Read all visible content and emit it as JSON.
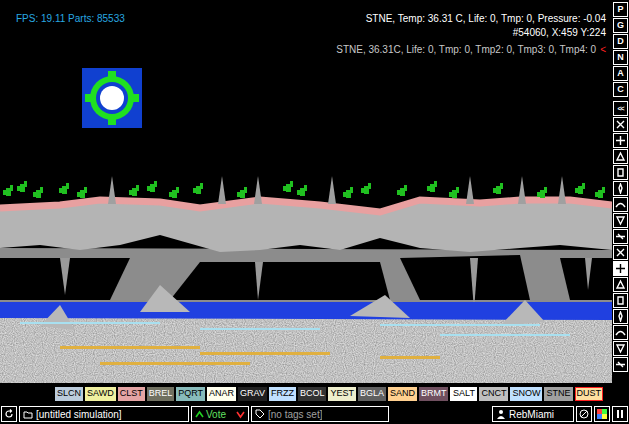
{
  "hud": {
    "fps": "FPS: 19.11 Parts: 85533",
    "lines": [
      "STNE, Temp: 36.31 C, Life: 0, Tmp: 0, Pressure: -0.04",
      "#54060, X:459 Y:224"
    ],
    "detail": "STNE, 36.31C, Life: 0, Tmp: 0, Tmp2: 0, Tmp3: 0, Tmp4: 0",
    "detail_marker": "<"
  },
  "sidebar": {
    "modes": [
      {
        "label": "P",
        "selected": false
      },
      {
        "label": "G",
        "selected": false
      },
      {
        "label": "D",
        "selected": false
      },
      {
        "label": "N",
        "selected": false
      },
      {
        "label": "A",
        "selected": false
      },
      {
        "label": "C",
        "selected": false
      }
    ],
    "collapse": "<<",
    "categories": [
      {
        "selected": false
      },
      {
        "selected": false
      },
      {
        "selected": false
      },
      {
        "selected": false
      },
      {
        "selected": false
      },
      {
        "selected": false
      },
      {
        "selected": false
      },
      {
        "selected": false
      },
      {
        "selected": false
      },
      {
        "selected": true
      },
      {
        "selected": false
      },
      {
        "selected": false
      },
      {
        "selected": false
      },
      {
        "selected": false
      },
      {
        "selected": false
      },
      {
        "selected": false
      }
    ]
  },
  "elements": [
    {
      "label": "SLCN",
      "color": "#bcccdc",
      "selected": false
    },
    {
      "label": "SAWD",
      "color": "#f0f0a0",
      "selected": false
    },
    {
      "label": "CLST",
      "color": "#e4a4a4",
      "selected": false
    },
    {
      "label": "BREL",
      "color": "#707060",
      "selected": false
    },
    {
      "label": "PQRT",
      "color": "#88bbbb",
      "selected": false
    },
    {
      "label": "ANAR",
      "color": "#ffffee",
      "selected": false
    },
    {
      "label": "GRAV",
      "color": "#202020",
      "selected": false
    },
    {
      "label": "FRZZ",
      "color": "#c0e0ff",
      "selected": false
    },
    {
      "label": "BCOL",
      "color": "#333333",
      "selected": false
    },
    {
      "label": "YEST",
      "color": "#eeeecc",
      "selected": false
    },
    {
      "label": "BGLA",
      "color": "#606060",
      "selected": false
    },
    {
      "label": "SAND",
      "color": "#ffd090",
      "selected": false
    },
    {
      "label": "BRMT",
      "color": "#705060",
      "selected": false
    },
    {
      "label": "SALT",
      "color": "#ffffff",
      "selected": false
    },
    {
      "label": "CNCT",
      "color": "#c0c0c0",
      "selected": false
    },
    {
      "label": "SNOW",
      "color": "#c0e0ff",
      "selected": false
    },
    {
      "label": "STNE",
      "color": "#a0a0a0",
      "selected": false
    },
    {
      "label": "DUST",
      "color": "#ffe0a0",
      "selected": true
    }
  ],
  "bottom_bar": {
    "save_name": "[untitled simulation]",
    "vote": "Vote",
    "tags": "[no tags set]",
    "user": "RebMiami"
  }
}
